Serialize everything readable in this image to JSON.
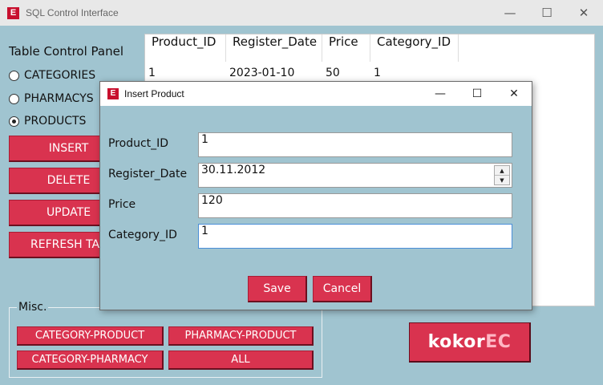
{
  "window": {
    "title": "SQL Control Interface",
    "logo_letter": "E",
    "minimize": "—",
    "maximize": "☐",
    "close": "✕"
  },
  "panel": {
    "title": "Table Control Panel",
    "radios": [
      {
        "label": "CATEGORIES",
        "checked": false
      },
      {
        "label": "PHARMACYS",
        "checked": false
      },
      {
        "label": "PRODUCTS",
        "checked": true
      }
    ],
    "buttons": [
      "INSERT",
      "DELETE",
      "UPDATE",
      "REFRESH TABLE"
    ]
  },
  "table": {
    "columns": [
      "Product_ID",
      "Register_Date",
      "Price",
      "Category_ID"
    ],
    "rows": [
      [
        "1",
        "2023-01-10",
        "50",
        "1"
      ]
    ]
  },
  "misc": {
    "label": "Misc.",
    "buttons": [
      "CATEGORY-PRODUCT",
      "PHARMACY-PRODUCT",
      "CATEGORY-PHARMACY",
      "ALL"
    ]
  },
  "brand": {
    "text_main": "kokor",
    "text_accent": "EC"
  },
  "dialog": {
    "title": "Insert Product",
    "logo_letter": "E",
    "minimize": "—",
    "maximize": "☐",
    "close": "✕",
    "fields": [
      {
        "label": "Product_ID",
        "value": "1"
      },
      {
        "label": "Register_Date",
        "value": "30.11.2012"
      },
      {
        "label": "Price",
        "value": "120"
      },
      {
        "label": "Category_ID",
        "value": "1"
      }
    ],
    "save_label": "Save",
    "cancel_label": "Cancel"
  },
  "colors": {
    "background": "#a0c4d0",
    "button_red": "#d9334f",
    "focus_blue": "#4a8ed8"
  }
}
